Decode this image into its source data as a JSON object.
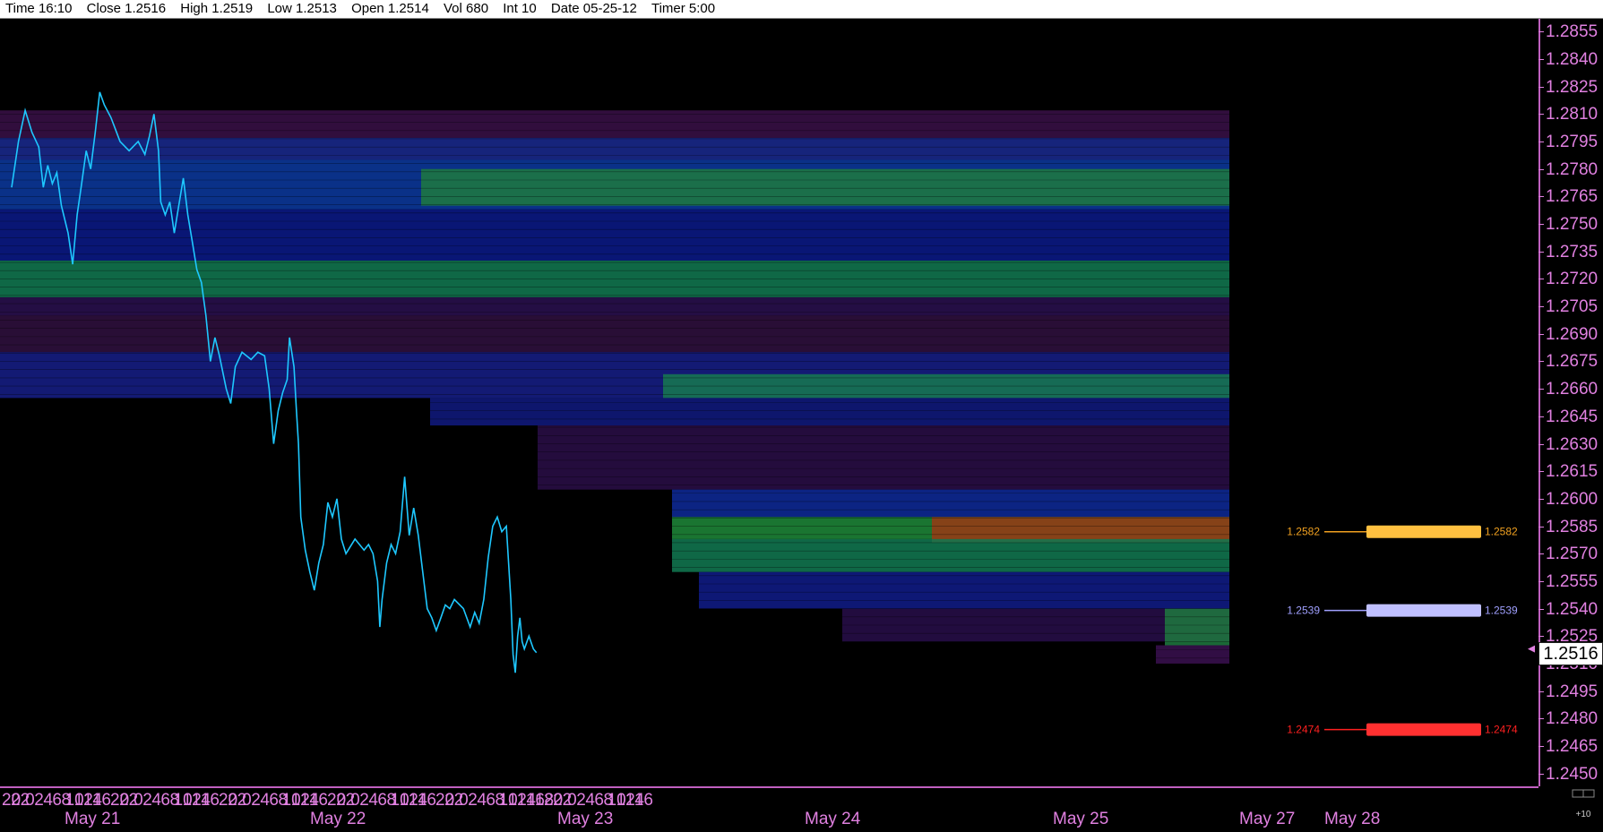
{
  "infobar": {
    "time": "Time 16:10",
    "close": "Close 1.2516",
    "high": "High 1.2519",
    "low": "Low 1.2513",
    "open": "Open 1.2514",
    "vol": "Vol 680",
    "int": "Int 10",
    "date": "Date 05-25-12",
    "timer": "Timer 5:00"
  },
  "current_price": "1.2516",
  "corner_label": "+10",
  "colors": {
    "background": "#000000",
    "price_line": "#1ec8ff",
    "axis": "#e080e0",
    "level_orange": "#f0a020",
    "level_blue": "#a0a0ff",
    "level_red": "#ff2020"
  },
  "levels": [
    {
      "price": 1.2582,
      "label": "1.2582",
      "color": "#f0a020",
      "bar": "#ffc040"
    },
    {
      "price": 1.2539,
      "label": "1.2539",
      "color": "#a0a0ff",
      "bar": "#c0c0ff"
    },
    {
      "price": 1.2474,
      "label": "1.2474",
      "color": "#ff2020",
      "bar": "#ff3030"
    }
  ],
  "chart_data": {
    "type": "line",
    "xlabel": "",
    "ylabel": "",
    "ylim": [
      1.2443,
      1.2862
    ],
    "grid": false,
    "y_ticks": [
      "1.2855",
      "1.2840",
      "1.2825",
      "1.2810",
      "1.2795",
      "1.2780",
      "1.2765",
      "1.2750",
      "1.2735",
      "1.2720",
      "1.2705",
      "1.2690",
      "1.2675",
      "1.2660",
      "1.2645",
      "1.2630",
      "1.2615",
      "1.2600",
      "1.2585",
      "1.2570",
      "1.2555",
      "1.2540",
      "1.2525",
      "1.2510",
      "1.2495",
      "1.2480",
      "1.2465",
      "1.2450"
    ],
    "x_hour_labels": [
      "20",
      "22",
      "0",
      "2",
      "4",
      "6",
      "8",
      "10",
      "12",
      "14",
      "16",
      "20",
      "22",
      "0",
      "2",
      "4",
      "6",
      "8",
      "10",
      "12",
      "14",
      "16",
      "20",
      "22",
      "0",
      "2",
      "4",
      "6",
      "8",
      "10",
      "12",
      "14",
      "16",
      "20",
      "22",
      "0",
      "2",
      "4",
      "6",
      "8",
      "10",
      "12",
      "14",
      "16",
      "20",
      "22",
      "0",
      "2",
      "4",
      "6",
      "8",
      "10",
      "12",
      "14",
      "16",
      "18",
      "20",
      "22",
      "0",
      "2",
      "4",
      "6",
      "8",
      "10",
      "12",
      "14",
      "16"
    ],
    "x_day_labels": [
      "May 21",
      "May 22",
      "May 23",
      "May 24",
      "May 25",
      "May 27",
      "May 28"
    ],
    "series": [
      {
        "values": [
          [
            "May 20 20:00",
            1.277
          ],
          [
            "May 20 21:30",
            1.2795
          ],
          [
            "May 20 23:00",
            1.2812
          ],
          [
            "May 21 00:30",
            1.28
          ],
          [
            "May 21 02:00",
            1.2792
          ],
          [
            "May 21 03:00",
            1.277
          ],
          [
            "May 21 04:00",
            1.2782
          ],
          [
            "May 21 05:00",
            1.2772
          ],
          [
            "May 21 06:00",
            1.2778
          ],
          [
            "May 21 07:00",
            1.276
          ],
          [
            "May 21 08:30",
            1.2745
          ],
          [
            "May 21 09:30",
            1.2728
          ],
          [
            "May 21 10:30",
            1.2755
          ],
          [
            "May 21 11:30",
            1.2772
          ],
          [
            "May 21 12:30",
            1.279
          ],
          [
            "May 21 13:30",
            1.278
          ],
          [
            "May 21 14:30",
            1.28
          ],
          [
            "May 21 15:30",
            1.2822
          ],
          [
            "May 21 16:30",
            1.2815
          ],
          [
            "May 21 18:00",
            1.2808
          ],
          [
            "May 21 20:00",
            1.2795
          ],
          [
            "May 21 22:00",
            1.279
          ],
          [
            "May 22 00:00",
            1.2795
          ],
          [
            "May 22 01:30",
            1.2788
          ],
          [
            "May 22 02:30",
            1.2798
          ],
          [
            "May 22 03:30",
            1.281
          ],
          [
            "May 22 04:30",
            1.279
          ],
          [
            "May 22 05:00",
            1.2762
          ],
          [
            "May 22 06:00",
            1.2755
          ],
          [
            "May 22 07:00",
            1.2762
          ],
          [
            "May 22 08:00",
            1.2745
          ],
          [
            "May 22 09:00",
            1.276
          ],
          [
            "May 22 10:00",
            1.2775
          ],
          [
            "May 22 11:00",
            1.2755
          ],
          [
            "May 22 12:00",
            1.274
          ],
          [
            "May 22 13:00",
            1.2725
          ],
          [
            "May 22 14:00",
            1.2718
          ],
          [
            "May 22 15:00",
            1.27
          ],
          [
            "May 22 16:00",
            1.2675
          ],
          [
            "May 22 17:00",
            1.2688
          ],
          [
            "May 22 18:00",
            1.2678
          ],
          [
            "May 22 19:30",
            1.266
          ],
          [
            "May 22 20:30",
            1.2652
          ],
          [
            "May 22 21:30",
            1.2672
          ],
          [
            "May 22 23:00",
            1.268
          ],
          [
            "May 23 01:00",
            1.2676
          ],
          [
            "May 23 02:30",
            1.268
          ],
          [
            "May 23 04:00",
            1.2678
          ],
          [
            "May 23 05:00",
            1.266
          ],
          [
            "May 23 06:00",
            1.263
          ],
          [
            "May 23 07:00",
            1.2648
          ],
          [
            "May 23 08:00",
            1.2658
          ],
          [
            "May 23 09:00",
            1.2665
          ],
          [
            "May 23 09:30",
            1.2688
          ],
          [
            "May 23 10:30",
            1.2672
          ],
          [
            "May 23 11:00",
            1.265
          ],
          [
            "May 23 11:30",
            1.263
          ],
          [
            "May 23 12:00",
            1.259
          ],
          [
            "May 23 13:00",
            1.2572
          ],
          [
            "May 23 14:00",
            1.256
          ],
          [
            "May 23 15:00",
            1.255
          ],
          [
            "May 23 16:00",
            1.2565
          ],
          [
            "May 23 17:00",
            1.2575
          ],
          [
            "May 23 18:00",
            1.2598
          ],
          [
            "May 23 19:00",
            1.259
          ],
          [
            "May 23 20:00",
            1.26
          ],
          [
            "May 23 21:00",
            1.2578
          ],
          [
            "May 23 22:00",
            1.257
          ],
          [
            "May 24 00:00",
            1.2578
          ],
          [
            "May 24 02:00",
            1.2572
          ],
          [
            "May 24 03:00",
            1.2575
          ],
          [
            "May 24 04:00",
            1.257
          ],
          [
            "May 24 05:00",
            1.2555
          ],
          [
            "May 24 05:30",
            1.253
          ],
          [
            "May 24 06:00",
            1.2545
          ],
          [
            "May 24 07:00",
            1.2565
          ],
          [
            "May 24 08:00",
            1.2575
          ],
          [
            "May 24 09:00",
            1.257
          ],
          [
            "May 24 10:00",
            1.2582
          ],
          [
            "May 24 11:00",
            1.2612
          ],
          [
            "May 24 12:00",
            1.258
          ],
          [
            "May 24 13:00",
            1.2595
          ],
          [
            "May 24 14:00",
            1.258
          ],
          [
            "May 24 15:00",
            1.256
          ],
          [
            "May 24 16:00",
            1.254
          ],
          [
            "May 24 17:00",
            1.2535
          ],
          [
            "May 24 18:00",
            1.2528
          ],
          [
            "May 24 19:00",
            1.2535
          ],
          [
            "May 24 20:00",
            1.2542
          ],
          [
            "May 24 21:00",
            1.254
          ],
          [
            "May 24 22:00",
            1.2545
          ],
          [
            "May 25 00:00",
            1.254
          ],
          [
            "May 25 01:30",
            1.253
          ],
          [
            "May 25 02:30",
            1.2538
          ],
          [
            "May 25 03:30",
            1.2532
          ],
          [
            "May 25 04:30",
            1.2545
          ],
          [
            "May 25 05:30",
            1.2568
          ],
          [
            "May 25 06:30",
            1.2585
          ],
          [
            "May 25 07:30",
            1.259
          ],
          [
            "May 25 08:30",
            1.2582
          ],
          [
            "May 25 09:30",
            1.2585
          ],
          [
            "May 25 10:00",
            1.2565
          ],
          [
            "May 25 10:30",
            1.2545
          ],
          [
            "May 25 11:00",
            1.2515
          ],
          [
            "May 25 11:30",
            1.2505
          ],
          [
            "May 25 12:00",
            1.2525
          ],
          [
            "May 25 12:30",
            1.2535
          ],
          [
            "May 25 13:00",
            1.2522
          ],
          [
            "May 25 13:30",
            1.2518
          ],
          [
            "May 25 14:30",
            1.2525
          ],
          [
            "May 25 15:30",
            1.2518
          ],
          [
            "May 25 16:10",
            1.2516
          ]
        ]
      }
    ]
  }
}
